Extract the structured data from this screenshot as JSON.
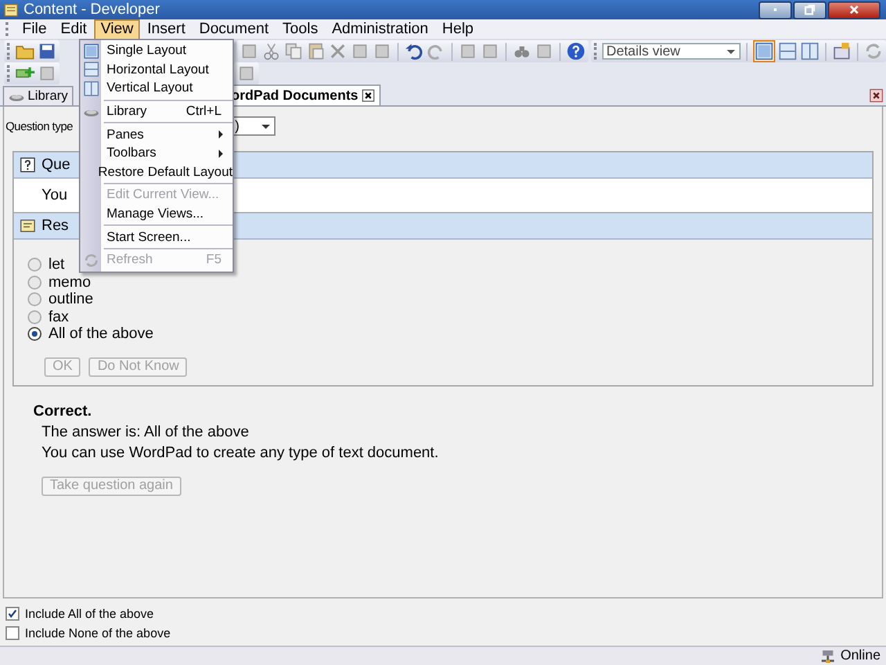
{
  "window": {
    "title": "Content - Developer"
  },
  "menubar": [
    {
      "label": "File",
      "selected": false
    },
    {
      "label": "Edit",
      "selected": false
    },
    {
      "label": "View",
      "selected": true
    },
    {
      "label": "Insert",
      "selected": false
    },
    {
      "label": "Document",
      "selected": false
    },
    {
      "label": "Tools",
      "selected": false
    },
    {
      "label": "Administration",
      "selected": false
    },
    {
      "label": "Help",
      "selected": false
    }
  ],
  "view_menu": [
    {
      "kind": "item",
      "label": "Single Layout",
      "disabled": false
    },
    {
      "kind": "item",
      "label": "Horizontal Layout",
      "disabled": false
    },
    {
      "kind": "item",
      "label": "Vertical Layout",
      "disabled": false
    },
    {
      "kind": "separator"
    },
    {
      "kind": "item",
      "label": "Library",
      "shortcut": "Ctrl+L",
      "disabled": false
    },
    {
      "kind": "separator"
    },
    {
      "kind": "submenu",
      "label": "Panes",
      "disabled": false
    },
    {
      "kind": "submenu",
      "label": "Toolbars",
      "disabled": false
    },
    {
      "kind": "item",
      "label": "Restore Default Layout",
      "disabled": false
    },
    {
      "kind": "separator"
    },
    {
      "kind": "item",
      "label": "Edit Current View...",
      "disabled": true
    },
    {
      "kind": "item",
      "label": "Manage Views...",
      "disabled": false
    },
    {
      "kind": "separator"
    },
    {
      "kind": "item",
      "label": "Start Screen...",
      "disabled": false
    },
    {
      "kind": "separator"
    },
    {
      "kind": "item",
      "label": "Refresh",
      "shortcut": "F5",
      "disabled": true
    }
  ],
  "toolbar": {
    "view_dropdown": "Details view"
  },
  "tabs": [
    {
      "label": "Library",
      "selected": false
    },
    {
      "label": "ordPad Documents",
      "selected": true
    }
  ],
  "question_type": {
    "label": "Question type",
    "value": ")"
  },
  "question_section": {
    "title": "Que",
    "text": "You"
  },
  "response_section": {
    "title": "Res",
    "options": [
      {
        "label": "let",
        "selected": false
      },
      {
        "label": "memo",
        "selected": false
      },
      {
        "label": "outline",
        "selected": false
      },
      {
        "label": "fax",
        "selected": false
      },
      {
        "label": "All of the above",
        "selected": true
      }
    ],
    "buttons": [
      {
        "label": "OK",
        "disabled": true
      },
      {
        "label": "Do Not Know",
        "disabled": true
      }
    ]
  },
  "feedback": {
    "title": "Correct.",
    "lines": [
      "The answer is: All of the above",
      "You can use WordPad to create any type of text document."
    ],
    "button": {
      "label": "Take question again",
      "disabled": true
    }
  },
  "options": [
    {
      "label": "Include All of the above",
      "checked": true
    },
    {
      "label": "Include None of the above",
      "checked": false
    }
  ],
  "status_bar": {
    "status": "Online"
  }
}
